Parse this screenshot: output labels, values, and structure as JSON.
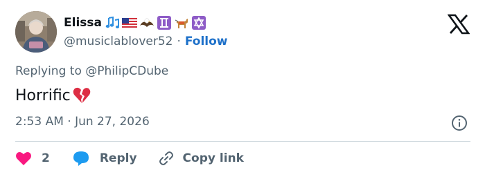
{
  "user": {
    "display_name": "Elissa",
    "handle": "@musiclablover52",
    "follow_label": "Follow",
    "separator": "·",
    "name_emojis": [
      "musical-notes-icon",
      "us-flag-icon",
      "eagle-icon",
      "gemini-icon",
      "service-dog-icon",
      "star-of-david-icon"
    ]
  },
  "tweet": {
    "replying_to": "Replying to @PhilipCDube",
    "text": "Horrific",
    "text_emoji": "broken-heart-icon",
    "timestamp": "2:53 AM · Jun 27, 2026"
  },
  "actions": {
    "like_count": "2",
    "reply_label": "Reply",
    "copy_link_label": "Copy link"
  },
  "colors": {
    "accent": "#1d9bf0",
    "follow": "#1d70c9",
    "like": "#f91880",
    "muted": "#536471",
    "text": "#0f1419",
    "divider": "#cfd9de"
  }
}
